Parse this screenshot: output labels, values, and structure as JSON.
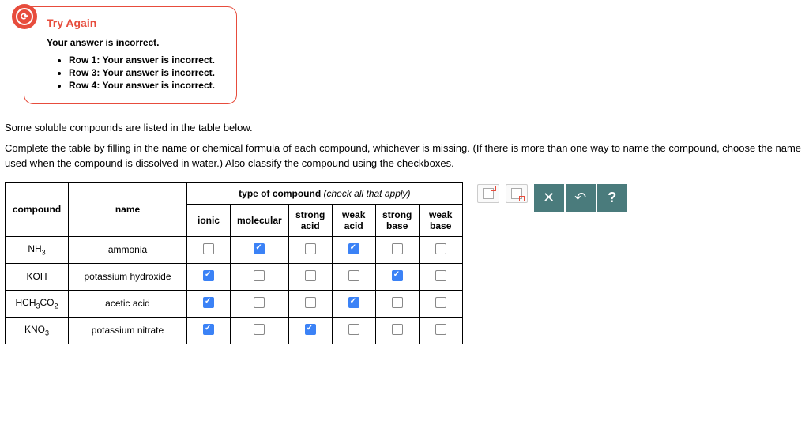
{
  "feedback": {
    "title": "Try Again",
    "subtitle": "Your answer is incorrect.",
    "items": [
      "Row 1: Your answer is incorrect.",
      "Row 3: Your answer is incorrect.",
      "Row 4: Your answer is incorrect."
    ]
  },
  "question": {
    "line1": "Some soluble compounds are listed in the table below.",
    "line2": "Complete the table by filling in the name or chemical formula of each compound, whichever is missing. (If there is more than one way to name the compound, choose the name used when the compound is dissolved in water.) Also classify the compound using the checkboxes."
  },
  "table": {
    "headers": {
      "compound": "compound",
      "name": "name",
      "type_label": "type of compound ",
      "type_hint": "(check all that apply)",
      "cols": [
        "ionic",
        "molecular",
        "strong acid",
        "weak acid",
        "strong base",
        "weak base"
      ]
    },
    "rows": [
      {
        "formula_html": "NH<sub>3</sub>",
        "name": "ammonia",
        "checks": [
          false,
          true,
          false,
          true,
          false,
          false
        ]
      },
      {
        "formula_html": "KOH",
        "name": "potassium hydroxide",
        "checks": [
          true,
          false,
          false,
          false,
          true,
          false
        ]
      },
      {
        "formula_html": "HCH<sub>3</sub>CO<sub>2</sub>",
        "name": "acetic acid",
        "checks": [
          true,
          false,
          false,
          true,
          false,
          false
        ]
      },
      {
        "formula_html": "KNO<sub>3</sub>",
        "name": "potassium nitrate",
        "checks": [
          true,
          false,
          true,
          false,
          false,
          false
        ]
      }
    ]
  },
  "icons": {
    "feedback_glyph": "⟳",
    "close": "✕",
    "undo": "↶",
    "help": "?"
  }
}
